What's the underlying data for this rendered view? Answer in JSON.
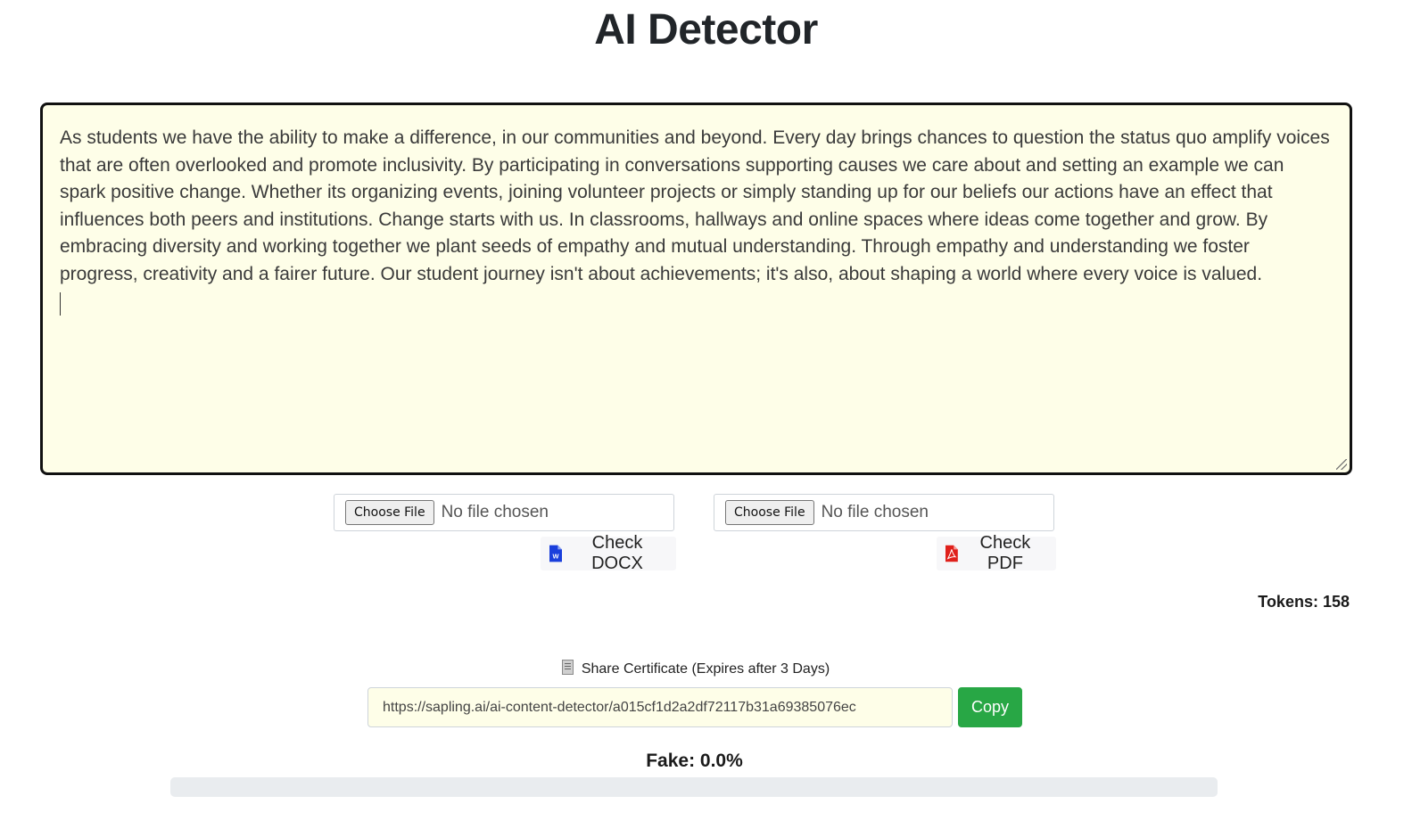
{
  "header": {
    "title": "AI Detector"
  },
  "editor": {
    "text": "As students we have the ability to make a difference, in our communities and beyond. Every day brings chances to question the status quo amplify voices that are often overlooked and promote inclusivity. By participating in conversations supporting causes we care about and setting an example we can spark positive change. Whether its organizing events, joining volunteer projects or simply standing up for our beliefs our actions have an effect that influences both peers and institutions. Change starts with us. In classrooms, hallways and online spaces where ideas come together and grow. By embracing diversity and working together we plant seeds of empathy and mutual understanding. Through empathy and understanding we foster progress, creativity and a fairer future. Our student journey isn't about achievements; it's also, about shaping a world where every voice is valued."
  },
  "uploads": {
    "docx": {
      "choose_label": "Choose File",
      "status": "No file chosen",
      "check_label": "Check DOCX",
      "icon": "word-icon",
      "icon_color": "#1a3fdc"
    },
    "pdf": {
      "choose_label": "Choose File",
      "status": "No file chosen",
      "check_label": "Check PDF",
      "icon": "pdf-icon",
      "icon_color": "#e0201b"
    }
  },
  "stats": {
    "tokens_label": "Tokens: 158"
  },
  "share": {
    "label": "Share Certificate (Expires after 3 Days)",
    "icon": "receipt-icon",
    "url": "https://sapling.ai/ai-content-detector/a015cf1d2a2df72117b31a69385076ec",
    "copy_label": "Copy",
    "copy_color": "#28a745"
  },
  "result": {
    "fake_label": "Fake: 0.0%",
    "fake_fraction": 0.0
  }
}
